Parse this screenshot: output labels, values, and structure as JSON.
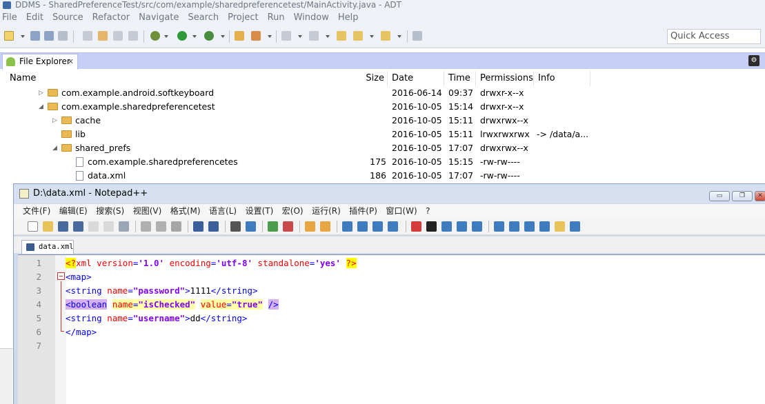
{
  "colors": {
    "eclipse_tabbar": "#c7cef4",
    "folder": "#e9b955",
    "xml_tag": "#0000ff",
    "xml_attr": "#ff0000",
    "xml_value": "#8000ff",
    "highlight_yellow": "#ffff00",
    "highlight_purple": "#d7b0f0"
  },
  "eclipse": {
    "title": "DDMS - SharedPreferenceTest/src/com/example/sharedpreferencetest/MainActivity.java - ADT",
    "menu": [
      "File",
      "Edit",
      "Source",
      "Refactor",
      "Navigate",
      "Search",
      "Project",
      "Run",
      "Window",
      "Help"
    ],
    "quick_access": "Quick Access",
    "file_explorer": {
      "tab_label": "File Explorer",
      "tab_close": "✕",
      "columns": {
        "name": "Name",
        "size": "Size",
        "date": "Date",
        "time": "Time",
        "permissions": "Permissions",
        "info": "Info"
      },
      "rows": [
        {
          "twisty": "▷",
          "icon": "folder-icon",
          "name": "com.example.android.softkeyboard",
          "size": "",
          "date": "2016-06-14",
          "time": "09:37",
          "permissions": "drwxr-x--x",
          "info": ""
        },
        {
          "twisty": "◢",
          "icon": "folder-icon",
          "name": "com.example.sharedpreferencetest",
          "size": "",
          "date": "2016-10-05",
          "time": "15:14",
          "permissions": "drwxr-x--x",
          "info": ""
        },
        {
          "twisty": "▷",
          "icon": "folder-icon",
          "name": "cache",
          "size": "",
          "date": "2016-10-05",
          "time": "15:11",
          "permissions": "drwxrwx--x",
          "info": ""
        },
        {
          "twisty": "",
          "icon": "folder-icon",
          "name": "lib",
          "size": "",
          "date": "2016-10-05",
          "time": "15:11",
          "permissions": "lrwxrwxrwx",
          "info": "-> /data/a..."
        },
        {
          "twisty": "◢",
          "icon": "folder-icon",
          "name": "shared_prefs",
          "size": "",
          "date": "2016-10-05",
          "time": "17:07",
          "permissions": "drwxrwx--x",
          "info": ""
        },
        {
          "twisty": "",
          "icon": "file-icon",
          "name": "com.example.sharedpreferencetes",
          "size": "175",
          "date": "2016-10-05",
          "time": "15:15",
          "permissions": "-rw-rw----",
          "info": ""
        },
        {
          "twisty": "",
          "icon": "file-icon",
          "name": "data.xml",
          "size": "186",
          "date": "2016-10-05",
          "time": "17:07",
          "permissions": "-rw-rw----",
          "info": ""
        }
      ]
    }
  },
  "notepad": {
    "title": "D:\\data.xml - Notepad++",
    "window_buttons": {
      "minimize": "▭",
      "restore": "❐",
      "close": "✕"
    },
    "menu": [
      "文件(F)",
      "编辑(E)",
      "搜索(S)",
      "视图(V)",
      "格式(M)",
      "语言(L)",
      "设置(T)",
      "宏(O)",
      "运行(R)",
      "插件(P)",
      "窗口(W)",
      "?"
    ],
    "tab_label": "data.xml",
    "lines": [
      {
        "n": "1",
        "parts": [
          {
            "t": "<?",
            "c": "pi hl-y"
          },
          {
            "t": "xml ",
            "c": "attr"
          },
          {
            "t": "version",
            "c": "attr"
          },
          {
            "t": "=",
            "c": "tag"
          },
          {
            "t": "'1.0'",
            "c": "val"
          },
          {
            "t": " ",
            "c": ""
          },
          {
            "t": "encoding",
            "c": "attr"
          },
          {
            "t": "=",
            "c": "tag"
          },
          {
            "t": "'utf-8'",
            "c": "val"
          },
          {
            "t": " ",
            "c": ""
          },
          {
            "t": "standalone",
            "c": "attr"
          },
          {
            "t": "=",
            "c": "tag"
          },
          {
            "t": "'yes'",
            "c": "val"
          },
          {
            "t": " ",
            "c": ""
          },
          {
            "t": "?>",
            "c": "pi hl-y"
          }
        ]
      },
      {
        "n": "2",
        "parts": [
          {
            "t": "<map>",
            "c": "tag"
          }
        ]
      },
      {
        "n": "3",
        "parts": [
          {
            "t": "<string ",
            "c": "tag"
          },
          {
            "t": "name",
            "c": "attr"
          },
          {
            "t": "=",
            "c": "tag"
          },
          {
            "t": "\"password\"",
            "c": "val"
          },
          {
            "t": ">",
            "c": "tag"
          },
          {
            "t": "1111",
            "c": ""
          },
          {
            "t": "</string>",
            "c": "tag"
          }
        ]
      },
      {
        "n": "4",
        "parts": [
          {
            "t": "<boolean",
            "c": "tag hl-p"
          },
          {
            "t": " ",
            "c": ""
          },
          {
            "t": "name",
            "c": "attr hl-ly"
          },
          {
            "t": "=",
            "c": "tag hl-ly"
          },
          {
            "t": "\"isChecked\"",
            "c": "val hl-ly"
          },
          {
            "t": " ",
            "c": ""
          },
          {
            "t": "value",
            "c": "attr hl-ly"
          },
          {
            "t": "=",
            "c": "tag hl-ly"
          },
          {
            "t": "\"true\"",
            "c": "val hl-ly"
          },
          {
            "t": " ",
            "c": ""
          },
          {
            "t": "/>",
            "c": "tag hl-p"
          }
        ]
      },
      {
        "n": "5",
        "parts": [
          {
            "t": "<string ",
            "c": "tag"
          },
          {
            "t": "name",
            "c": "attr"
          },
          {
            "t": "=",
            "c": "tag"
          },
          {
            "t": "\"username\"",
            "c": "val"
          },
          {
            "t": ">",
            "c": "tag"
          },
          {
            "t": "dd",
            "c": ""
          },
          {
            "t": "</string>",
            "c": "tag"
          }
        ]
      },
      {
        "n": "6",
        "parts": [
          {
            "t": "</map>",
            "c": "tag"
          }
        ]
      },
      {
        "n": "7",
        "parts": []
      }
    ]
  }
}
